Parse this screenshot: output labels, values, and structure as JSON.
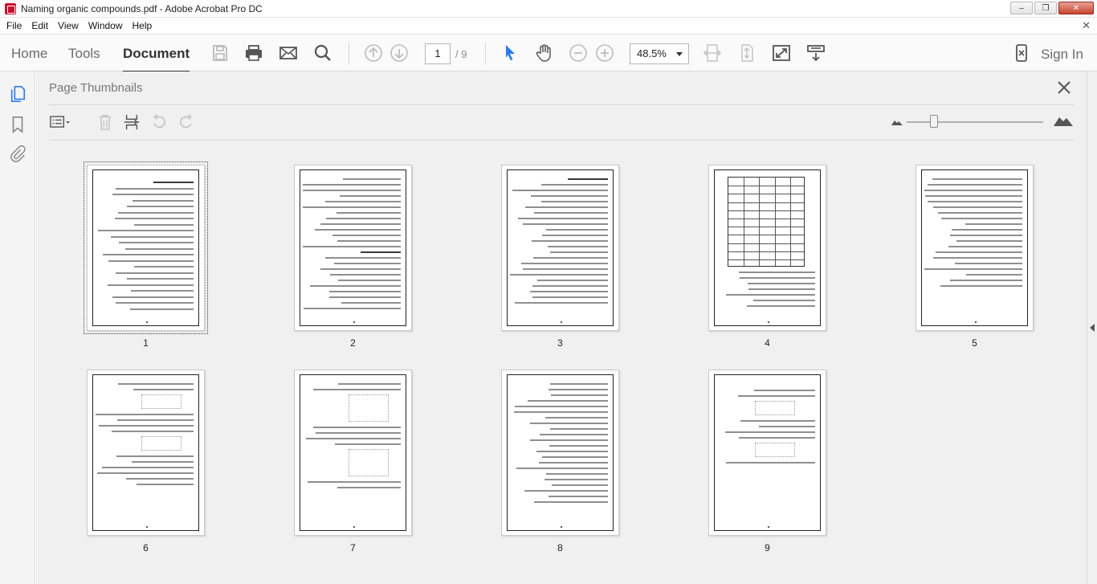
{
  "window": {
    "title": "Naming organic compounds.pdf - Adobe Acrobat Pro DC"
  },
  "menu": {
    "items": [
      "File",
      "Edit",
      "View",
      "Window",
      "Help"
    ]
  },
  "toolbar": {
    "tabs": {
      "home": "Home",
      "tools": "Tools",
      "document": "Document"
    },
    "page_current": "1",
    "page_total": "/ 9",
    "zoom": "48.5%",
    "sign_in": "Sign In"
  },
  "panel": {
    "title": "Page Thumbnails"
  },
  "thumbnails": {
    "labels": [
      "1",
      "2",
      "3",
      "4",
      "5",
      "6",
      "7",
      "8",
      "9"
    ],
    "selected": "1"
  },
  "colors": {
    "accent_cursor": "#2d7be5",
    "close_red": "#c6452f"
  }
}
